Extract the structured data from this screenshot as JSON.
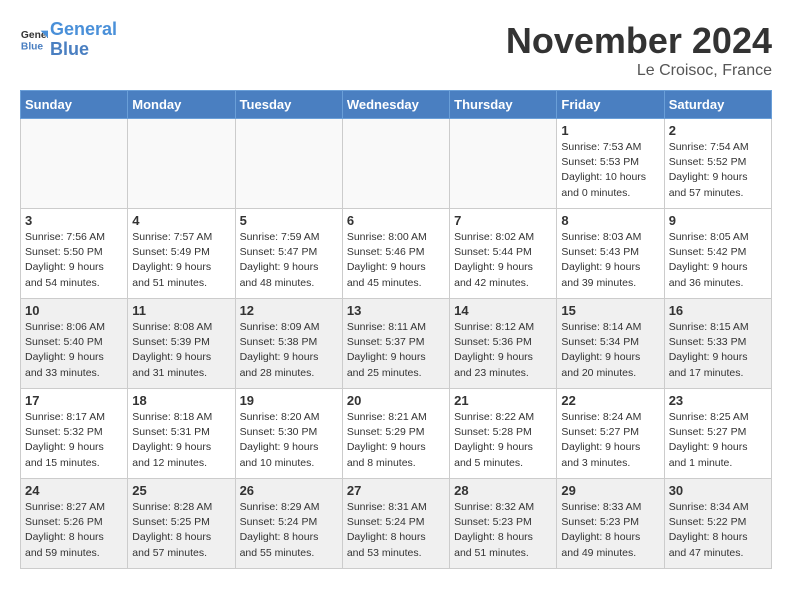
{
  "header": {
    "logo_line1": "General",
    "logo_line2": "Blue",
    "month": "November 2024",
    "location": "Le Croisoc, France"
  },
  "days_of_week": [
    "Sunday",
    "Monday",
    "Tuesday",
    "Wednesday",
    "Thursday",
    "Friday",
    "Saturday"
  ],
  "weeks": [
    [
      {
        "day": "",
        "info": "",
        "empty": true
      },
      {
        "day": "",
        "info": "",
        "empty": true
      },
      {
        "day": "",
        "info": "",
        "empty": true
      },
      {
        "day": "",
        "info": "",
        "empty": true
      },
      {
        "day": "",
        "info": "",
        "empty": true
      },
      {
        "day": "1",
        "info": "Sunrise: 7:53 AM\nSunset: 5:53 PM\nDaylight: 10 hours\nand 0 minutes.",
        "empty": false
      },
      {
        "day": "2",
        "info": "Sunrise: 7:54 AM\nSunset: 5:52 PM\nDaylight: 9 hours\nand 57 minutes.",
        "empty": false
      }
    ],
    [
      {
        "day": "3",
        "info": "Sunrise: 7:56 AM\nSunset: 5:50 PM\nDaylight: 9 hours\nand 54 minutes.",
        "empty": false
      },
      {
        "day": "4",
        "info": "Sunrise: 7:57 AM\nSunset: 5:49 PM\nDaylight: 9 hours\nand 51 minutes.",
        "empty": false
      },
      {
        "day": "5",
        "info": "Sunrise: 7:59 AM\nSunset: 5:47 PM\nDaylight: 9 hours\nand 48 minutes.",
        "empty": false
      },
      {
        "day": "6",
        "info": "Sunrise: 8:00 AM\nSunset: 5:46 PM\nDaylight: 9 hours\nand 45 minutes.",
        "empty": false
      },
      {
        "day": "7",
        "info": "Sunrise: 8:02 AM\nSunset: 5:44 PM\nDaylight: 9 hours\nand 42 minutes.",
        "empty": false
      },
      {
        "day": "8",
        "info": "Sunrise: 8:03 AM\nSunset: 5:43 PM\nDaylight: 9 hours\nand 39 minutes.",
        "empty": false
      },
      {
        "day": "9",
        "info": "Sunrise: 8:05 AM\nSunset: 5:42 PM\nDaylight: 9 hours\nand 36 minutes.",
        "empty": false
      }
    ],
    [
      {
        "day": "10",
        "info": "Sunrise: 8:06 AM\nSunset: 5:40 PM\nDaylight: 9 hours\nand 33 minutes.",
        "empty": false
      },
      {
        "day": "11",
        "info": "Sunrise: 8:08 AM\nSunset: 5:39 PM\nDaylight: 9 hours\nand 31 minutes.",
        "empty": false
      },
      {
        "day": "12",
        "info": "Sunrise: 8:09 AM\nSunset: 5:38 PM\nDaylight: 9 hours\nand 28 minutes.",
        "empty": false
      },
      {
        "day": "13",
        "info": "Sunrise: 8:11 AM\nSunset: 5:37 PM\nDaylight: 9 hours\nand 25 minutes.",
        "empty": false
      },
      {
        "day": "14",
        "info": "Sunrise: 8:12 AM\nSunset: 5:36 PM\nDaylight: 9 hours\nand 23 minutes.",
        "empty": false
      },
      {
        "day": "15",
        "info": "Sunrise: 8:14 AM\nSunset: 5:34 PM\nDaylight: 9 hours\nand 20 minutes.",
        "empty": false
      },
      {
        "day": "16",
        "info": "Sunrise: 8:15 AM\nSunset: 5:33 PM\nDaylight: 9 hours\nand 17 minutes.",
        "empty": false
      }
    ],
    [
      {
        "day": "17",
        "info": "Sunrise: 8:17 AM\nSunset: 5:32 PM\nDaylight: 9 hours\nand 15 minutes.",
        "empty": false
      },
      {
        "day": "18",
        "info": "Sunrise: 8:18 AM\nSunset: 5:31 PM\nDaylight: 9 hours\nand 12 minutes.",
        "empty": false
      },
      {
        "day": "19",
        "info": "Sunrise: 8:20 AM\nSunset: 5:30 PM\nDaylight: 9 hours\nand 10 minutes.",
        "empty": false
      },
      {
        "day": "20",
        "info": "Sunrise: 8:21 AM\nSunset: 5:29 PM\nDaylight: 9 hours\nand 8 minutes.",
        "empty": false
      },
      {
        "day": "21",
        "info": "Sunrise: 8:22 AM\nSunset: 5:28 PM\nDaylight: 9 hours\nand 5 minutes.",
        "empty": false
      },
      {
        "day": "22",
        "info": "Sunrise: 8:24 AM\nSunset: 5:27 PM\nDaylight: 9 hours\nand 3 minutes.",
        "empty": false
      },
      {
        "day": "23",
        "info": "Sunrise: 8:25 AM\nSunset: 5:27 PM\nDaylight: 9 hours\nand 1 minute.",
        "empty": false
      }
    ],
    [
      {
        "day": "24",
        "info": "Sunrise: 8:27 AM\nSunset: 5:26 PM\nDaylight: 8 hours\nand 59 minutes.",
        "empty": false
      },
      {
        "day": "25",
        "info": "Sunrise: 8:28 AM\nSunset: 5:25 PM\nDaylight: 8 hours\nand 57 minutes.",
        "empty": false
      },
      {
        "day": "26",
        "info": "Sunrise: 8:29 AM\nSunset: 5:24 PM\nDaylight: 8 hours\nand 55 minutes.",
        "empty": false
      },
      {
        "day": "27",
        "info": "Sunrise: 8:31 AM\nSunset: 5:24 PM\nDaylight: 8 hours\nand 53 minutes.",
        "empty": false
      },
      {
        "day": "28",
        "info": "Sunrise: 8:32 AM\nSunset: 5:23 PM\nDaylight: 8 hours\nand 51 minutes.",
        "empty": false
      },
      {
        "day": "29",
        "info": "Sunrise: 8:33 AM\nSunset: 5:23 PM\nDaylight: 8 hours\nand 49 minutes.",
        "empty": false
      },
      {
        "day": "30",
        "info": "Sunrise: 8:34 AM\nSunset: 5:22 PM\nDaylight: 8 hours\nand 47 minutes.",
        "empty": false
      }
    ]
  ]
}
